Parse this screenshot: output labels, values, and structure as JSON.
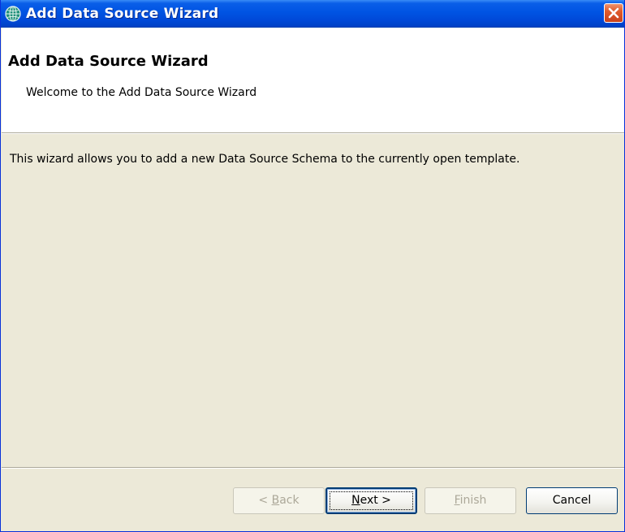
{
  "window": {
    "title": "Add Data Source Wizard",
    "icon": "globe-network-icon",
    "close_icon": "close-icon"
  },
  "header": {
    "title": "Add Data Source Wizard",
    "description": "Welcome to the Add Data Source Wizard"
  },
  "content": {
    "text": "This wizard allows you to add a new Data Source Schema to the currently open template."
  },
  "buttons": {
    "back": {
      "label": "< Back",
      "prefix": "< ",
      "mnemonic": "B",
      "rest": "ack",
      "enabled": false
    },
    "next": {
      "label": "Next >",
      "mnemonic": "N",
      "rest": "ext >",
      "enabled": true,
      "default": true
    },
    "finish": {
      "label": "Finish",
      "mnemonic": "F",
      "rest": "inish",
      "enabled": false
    },
    "cancel": {
      "label": "Cancel",
      "enabled": true
    }
  },
  "colors": {
    "titlebar": "#0054E3",
    "dialog_bg": "#ECE9D8",
    "close_button": "#E05B2B"
  }
}
